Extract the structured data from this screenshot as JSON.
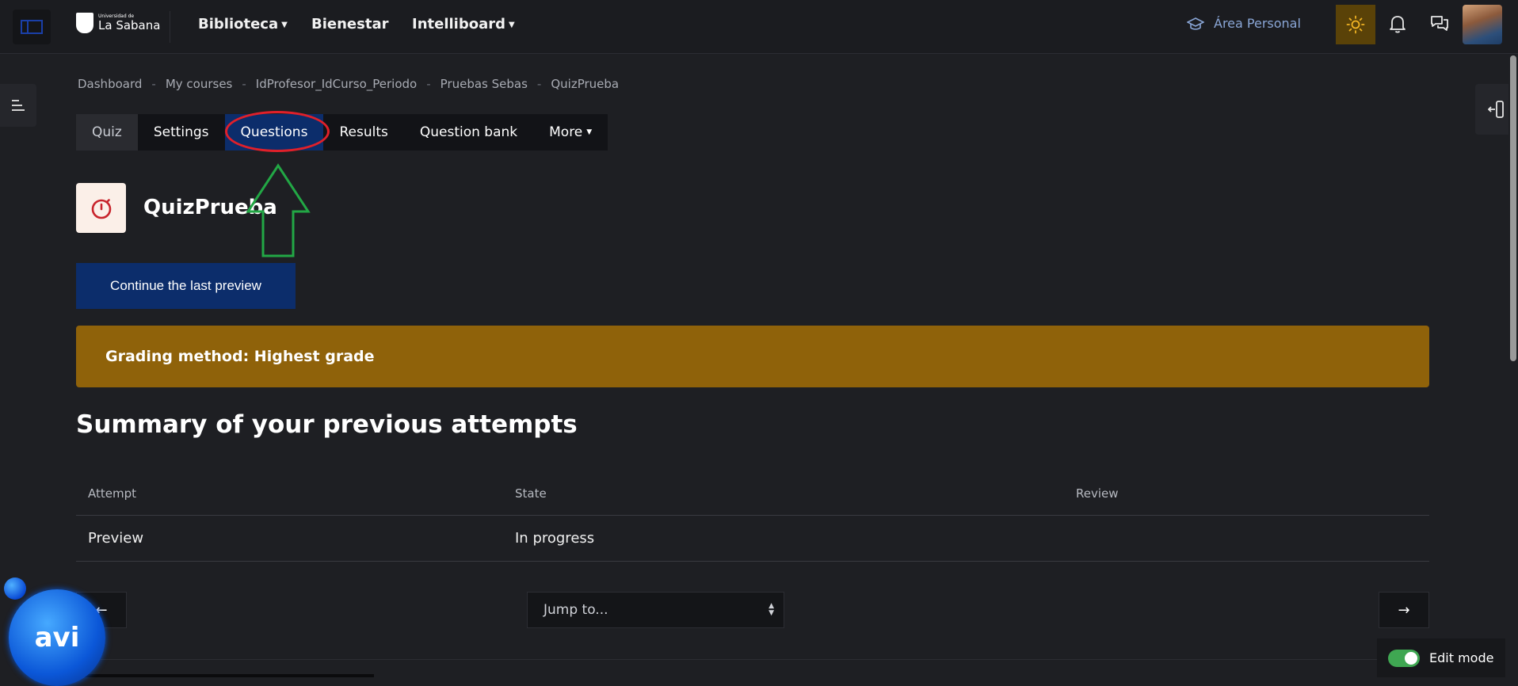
{
  "navbar": {
    "logo_small": "Universidad de",
    "logo_big": "La Sabana",
    "links": [
      "Biblioteca",
      "Bienestar",
      "Intelliboard"
    ],
    "area_personal": "Área Personal",
    "icons": [
      "sidebar-toggle-icon",
      "graduation-cap-icon",
      "sun-icon",
      "bell-icon",
      "chat-icon"
    ]
  },
  "breadcrumb": {
    "items": [
      "Dashboard",
      "My courses",
      "IdProfesor_IdCurso_Periodo",
      "Pruebas Sebas",
      "QuizPrueba"
    ],
    "separator": "-"
  },
  "tabs": [
    "Quiz",
    "Settings",
    "Questions",
    "Results",
    "Question bank",
    "More"
  ],
  "active_tab": "Questions",
  "page": {
    "title": "QuizPrueba",
    "continue_button": "Continue the last preview",
    "grading_method": "Grading method: Highest grade",
    "summary_heading": "Summary of your previous attempts"
  },
  "table": {
    "headers": [
      "Attempt",
      "State",
      "Review"
    ],
    "rows": [
      [
        "Preview",
        "In progress",
        ""
      ]
    ]
  },
  "pagination": {
    "jump_placeholder": "Jump to..."
  },
  "edit_mode": {
    "label": "Edit mode",
    "enabled": true
  },
  "assistant": {
    "label": "avi"
  },
  "colors": {
    "background": "#1e1f23",
    "primary": "#0c2d6b",
    "warning": "#8f620a",
    "highlight_circle": "#e0202a",
    "annotation_arrow": "#22a745",
    "toggle_on": "#3fa752"
  }
}
